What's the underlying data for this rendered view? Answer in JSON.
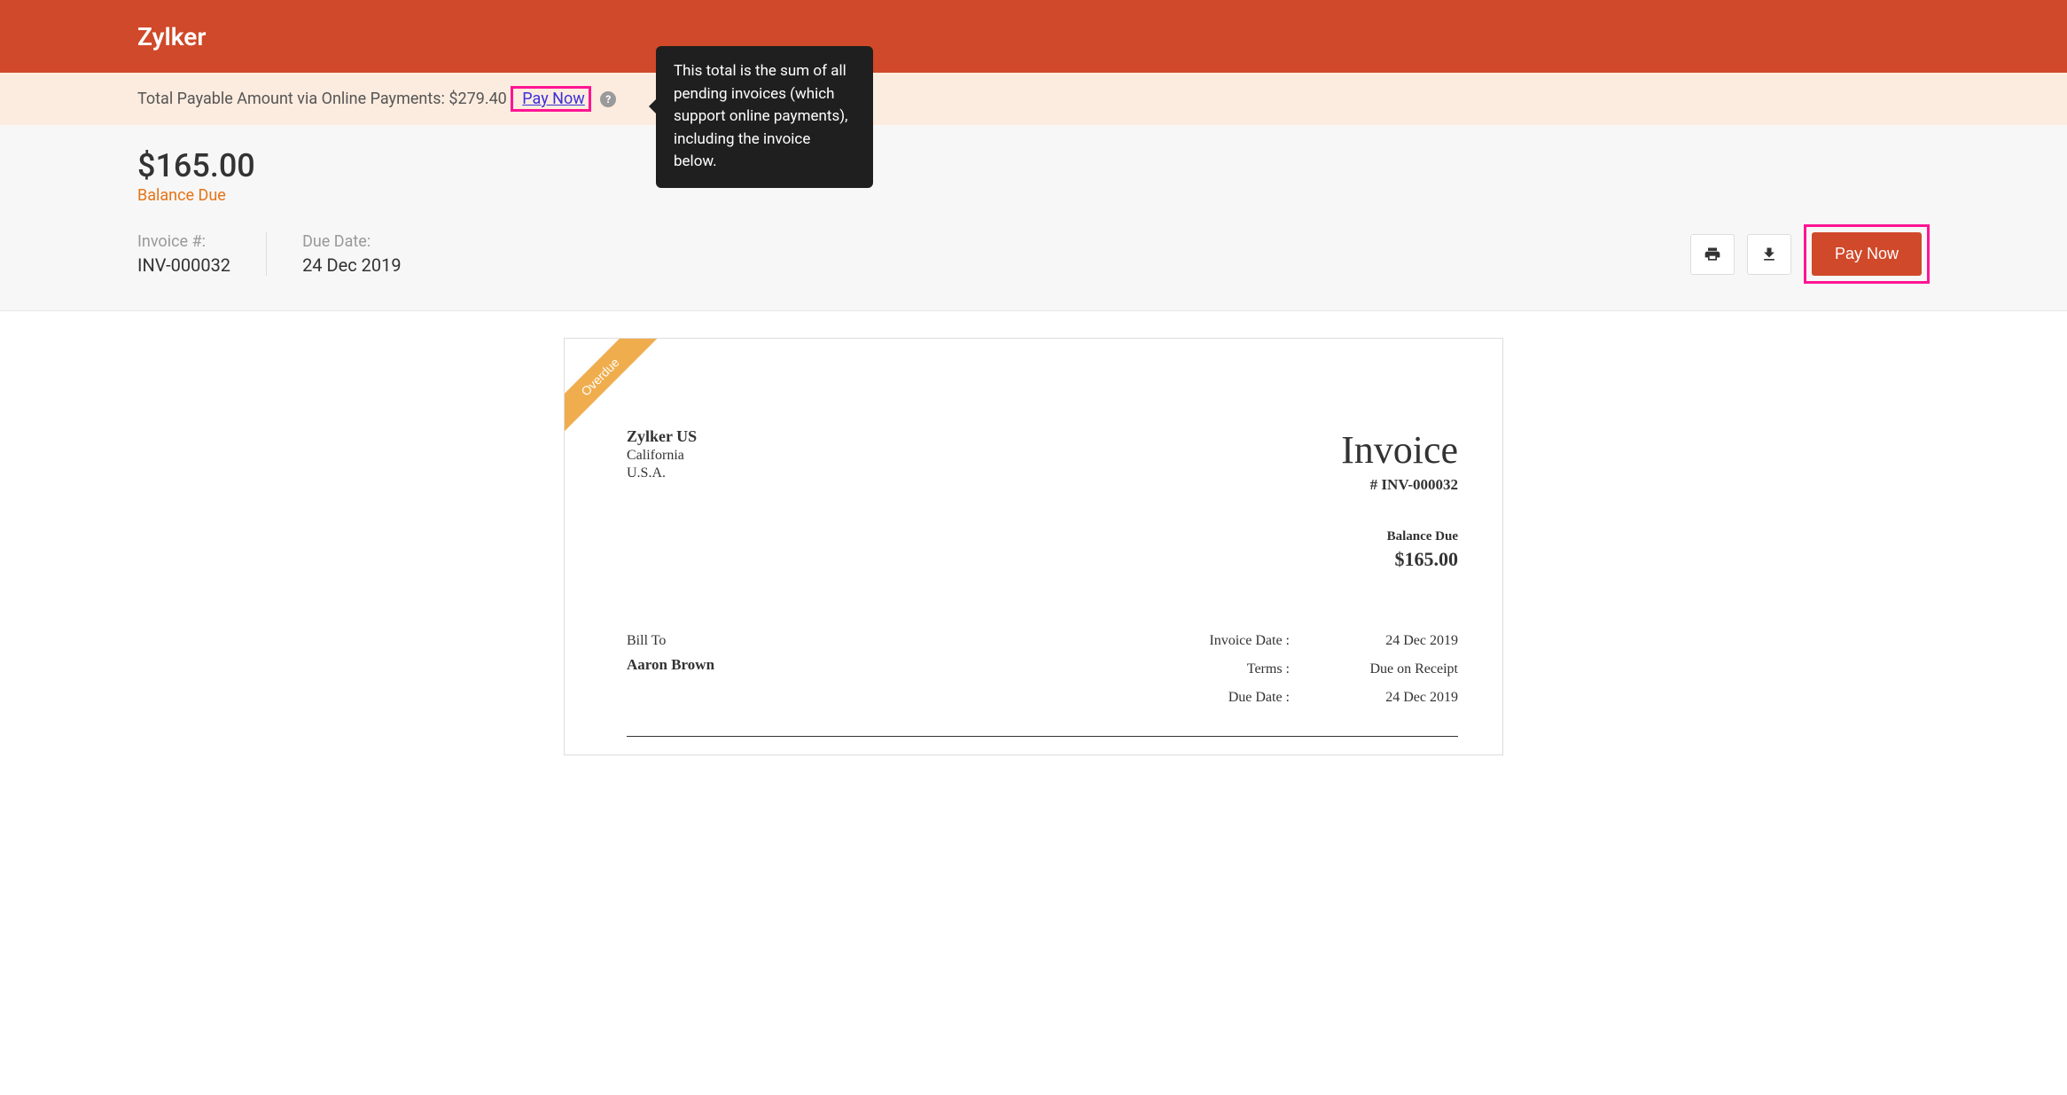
{
  "header": {
    "brand": "Zylker"
  },
  "payable_bar": {
    "label": "Total Payable Amount via Online Payments:",
    "amount": "$279.40",
    "paynow": "Pay Now",
    "help": "?",
    "tooltip": "This total is the sum of all pending invoices (which support online payments), including the invoice below."
  },
  "summary": {
    "balance_amount": "$165.00",
    "balance_label": "Balance Due",
    "invoice_num_label": "Invoice #:",
    "invoice_num": "INV-000032",
    "due_date_label": "Due Date:",
    "due_date": "24 Dec 2019",
    "pay_button": "Pay Now"
  },
  "invoice": {
    "ribbon": "Overdue",
    "from": {
      "org": "Zylker US",
      "region": "California",
      "country": "U.S.A."
    },
    "title": "Invoice",
    "number_prefix": "# INV-000032",
    "balance_label": "Balance Due",
    "balance_amount": "$165.00",
    "billto_label": "Bill To",
    "billto_name": "Aaron Brown",
    "dates": {
      "invoice_date_k": "Invoice Date :",
      "invoice_date_v": "24 Dec 2019",
      "terms_k": "Terms :",
      "terms_v": "Due on Receipt",
      "due_date_k": "Due Date :",
      "due_date_v": "24 Dec 2019"
    }
  }
}
